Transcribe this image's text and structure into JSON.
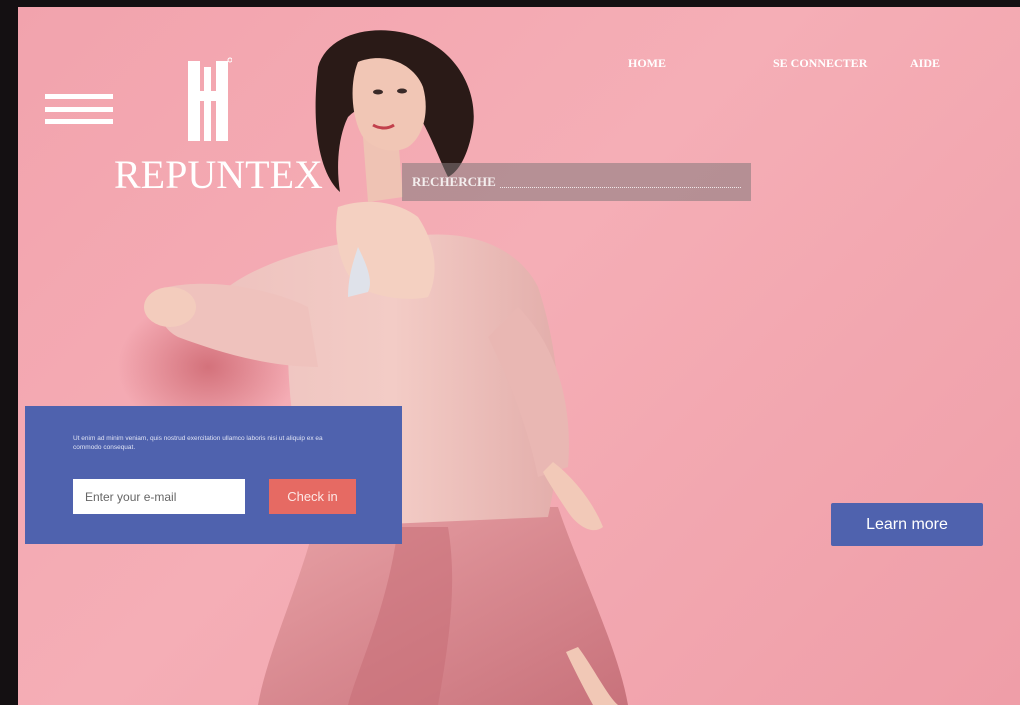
{
  "brand": {
    "name": "REPUNTEX",
    "logo_icon": "hotel-monogram-icon"
  },
  "nav": {
    "home": "HOME",
    "login": "SE CONNECTER",
    "help": "AIDE"
  },
  "menu": {
    "icon": "hamburger-icon"
  },
  "search": {
    "label": "RECHERCHE"
  },
  "signup": {
    "text": "Ut enim ad minim veniam, quis nostrud exercitation ullamco laboris nisi ut aliquip ex ea commodo consequat.",
    "email_placeholder": "Enter your e-mail",
    "button_label": "Check in"
  },
  "cta": {
    "learn_more": "Learn more"
  },
  "colors": {
    "background": "#f2a3ad",
    "panel": "#4f62ae",
    "accent_button": "#e66a63",
    "text_light": "#ffffff"
  }
}
